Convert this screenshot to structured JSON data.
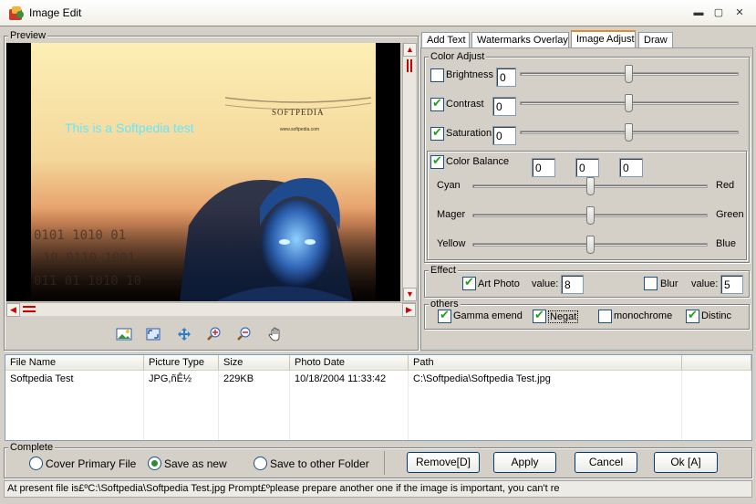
{
  "window": {
    "title": "Image Edit",
    "min_label": "▬",
    "max_label": "▢",
    "close_label": "✕"
  },
  "preview": {
    "label": "Preview",
    "overlay_text": "This is a Softpedia test",
    "logo_text": "SOFTPEDIA",
    "logo_url": "www.softpedia.com"
  },
  "tabs": [
    {
      "label": "Add Text"
    },
    {
      "label": "Watermarks Overlay"
    },
    {
      "label": "Image Adjust"
    },
    {
      "label": "Draw"
    }
  ],
  "color_adjust": {
    "label": "Color Adjust",
    "brightness": {
      "label": "Brightness",
      "value": "0",
      "checked": false,
      "level": 0.5
    },
    "contrast": {
      "label": "Contrast",
      "value": "0",
      "checked": true,
      "level": 0.5
    },
    "saturation": {
      "label": "Saturation",
      "value": "0",
      "checked": true,
      "level": 0.5
    },
    "color_balance": {
      "label": "Color Balance",
      "checked": true,
      "values": [
        "0",
        "0",
        "0"
      ],
      "rows": [
        {
          "left": "Cyan",
          "right": "Red",
          "level": 0.5
        },
        {
          "left": "Mager",
          "right": "Green",
          "level": 0.5
        },
        {
          "left": "Yellow",
          "right": "Blue",
          "level": 0.5
        }
      ]
    }
  },
  "effect": {
    "label": "Effect",
    "art_photo": {
      "label": "Art Photo",
      "checked": true,
      "value_label": "value:",
      "value": "8"
    },
    "blur": {
      "label": "Blur",
      "checked": false,
      "value_label": "value:",
      "value": "5"
    }
  },
  "others": {
    "label": "others",
    "items": [
      {
        "label": "Gamma emend",
        "checked": true
      },
      {
        "label": "Negat",
        "checked": true
      },
      {
        "label": "monochrome",
        "checked": false
      },
      {
        "label": "Distinc",
        "checked": true
      }
    ]
  },
  "file_list": {
    "headers": [
      "File Name",
      "Picture Type",
      "Size",
      "Photo Date",
      "Path"
    ],
    "rows": [
      {
        "name": "Softpedia Test",
        "type": "JPG,ñÊ½",
        "size": "229KB",
        "date": "10/18/2004 11:33:42",
        "path": "C:\\Softpedia\\Softpedia Test.jpg"
      }
    ]
  },
  "complete": {
    "label": "Complete",
    "options": [
      {
        "label": "Cover Primary File",
        "selected": false
      },
      {
        "label": "Save as new",
        "selected": true
      },
      {
        "label": "Save to other Folder",
        "selected": false
      }
    ],
    "buttons": {
      "remove": "Remove[D]",
      "apply": "Apply",
      "cancel": "Cancel",
      "ok": "Ok [A]"
    }
  },
  "status": {
    "text": "At present file is£ºC:\\Softpedia\\Softpedia Test.jpg  Prompt£ºplease prepare another one if the image is important, you can't re"
  },
  "colors": {
    "accent_tab": "#e68b2c",
    "check": "#21a121",
    "scroll_arrow": "#c00000"
  }
}
